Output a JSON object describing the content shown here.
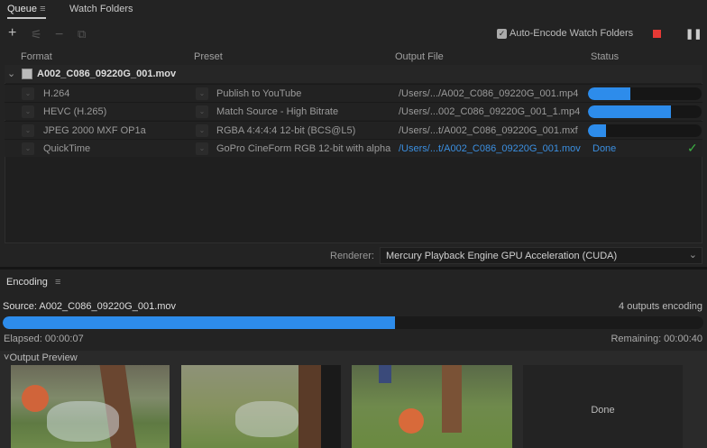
{
  "tabs": {
    "queue": "Queue",
    "watch": "Watch Folders"
  },
  "toolbar": {
    "add": "+",
    "settings": "⚟",
    "remove": "−",
    "duplicate": "⧉",
    "auto_encode": "Auto-Encode Watch Folders",
    "auto_encode_checked": true,
    "stop_color": "#e53935"
  },
  "columns": {
    "format": "Format",
    "preset": "Preset",
    "output": "Output File",
    "status": "Status"
  },
  "source": {
    "name": "A002_C086_09220G_001.mov"
  },
  "rows": [
    {
      "format": "H.264",
      "preset": "Publish to YouTube",
      "output": "/Users/.../A002_C086_09220G_001.mp4",
      "progress": 0.37
    },
    {
      "format": "HEVC (H.265)",
      "preset": "Match Source - High Bitrate",
      "output": "/Users/...002_C086_09220G_001_1.mp4",
      "progress": 0.73
    },
    {
      "format": "JPEG 2000 MXF OP1a",
      "preset": "RGBA 4:4:4:4 12-bit (BCS@L5)",
      "output": "/Users/...t/A002_C086_09220G_001.mxf",
      "progress": 0.16
    },
    {
      "format": "QuickTime",
      "preset": "GoPro CineForm RGB 12-bit with alpha",
      "output": "/Users/...t/A002_C086_09220G_001.mov",
      "status": "Done"
    }
  ],
  "renderer": {
    "label": "Renderer:",
    "value": "Mercury Playback Engine GPU Acceleration (CUDA)"
  },
  "encoding": {
    "title": "Encoding",
    "source": "Source: A002_C086_09220G_001.mov",
    "outputs": "4 outputs encoding",
    "progress": 0.56,
    "elapsed": "Elapsed: 00:00:07",
    "remaining": "Remaining: 00:00:40",
    "preview_label": "Output Preview",
    "done": "Done"
  },
  "colors": {
    "accent": "#2d8ceb",
    "done_check": "#3cb043"
  }
}
